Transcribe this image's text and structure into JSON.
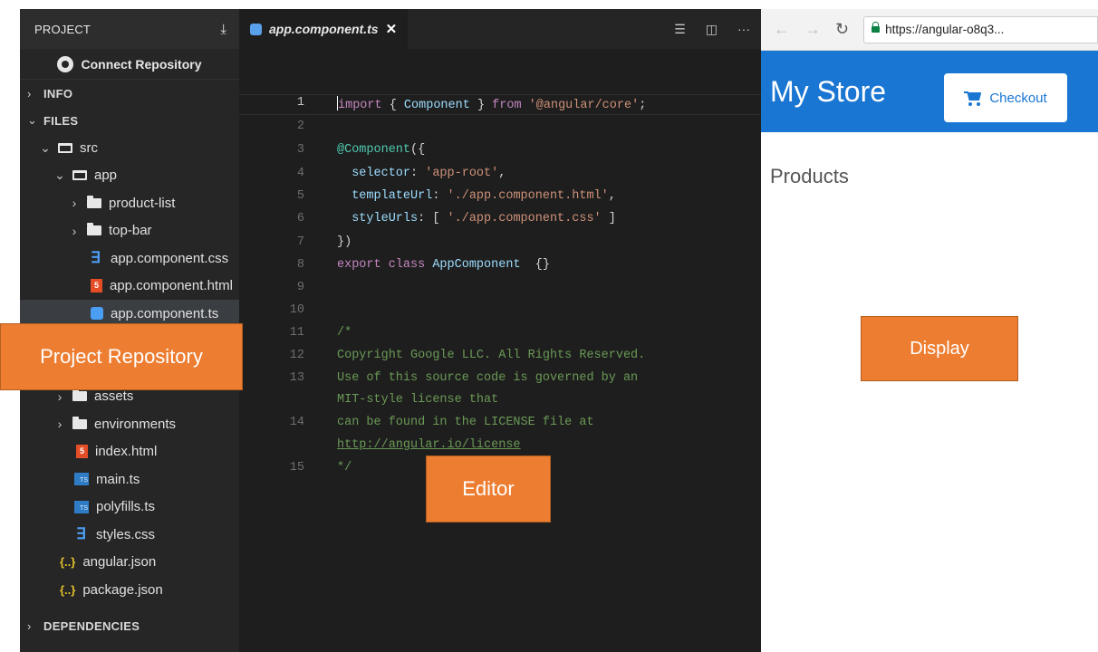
{
  "sidebar": {
    "header_title": "PROJECT",
    "connect_label": "Connect Repository",
    "sections": {
      "info": "INFO",
      "files": "FILES",
      "dependencies": "DEPENDENCIES"
    },
    "tree": [
      {
        "label": "src",
        "icon": "folder-open-icon",
        "expanded": true
      },
      {
        "label": "app",
        "icon": "folder-open-icon",
        "expanded": true
      },
      {
        "label": "product-list",
        "icon": "folder-icon",
        "expanded": false
      },
      {
        "label": "top-bar",
        "icon": "folder-icon",
        "expanded": false
      },
      {
        "label": "app.component.css",
        "icon": "css-file-icon"
      },
      {
        "label": "app.component.html",
        "icon": "html-file-icon"
      },
      {
        "label": "app.component.ts",
        "icon": "angular-file-icon",
        "selected": true
      },
      {
        "label": "assets",
        "icon": "folder-icon",
        "expanded": false
      },
      {
        "label": "environments",
        "icon": "folder-icon",
        "expanded": false
      },
      {
        "label": "index.html",
        "icon": "html-file-icon"
      },
      {
        "label": "main.ts",
        "icon": "ts-file-icon"
      },
      {
        "label": "polyfills.ts",
        "icon": "ts-file-icon"
      },
      {
        "label": "styles.css",
        "icon": "css-file-icon"
      },
      {
        "label": "angular.json",
        "icon": "json-file-icon"
      },
      {
        "label": "package.json",
        "icon": "json-file-icon"
      }
    ]
  },
  "editor": {
    "tab_name": "app.component.ts",
    "line_numbers": [
      "1",
      "2",
      "3",
      "4",
      "5",
      "6",
      "7",
      "8",
      "9",
      "10",
      "11",
      "12",
      "13",
      "14",
      "15"
    ],
    "code": {
      "l1_kw": "import",
      "l1_a": " { ",
      "l1_type": "Component",
      "l1_b": " } ",
      "l1_from": "from",
      "l1_str": " '@angular/core'",
      "l1_end": ";",
      "l3_dec": "@Component",
      "l3_rest": "({",
      "l4_key": "selector",
      "l4_colon": ": ",
      "l4_str": "'app-root'",
      "l4_end": ",",
      "l5_key": "templateUrl",
      "l5_colon": ": ",
      "l5_str": "'./app.component.html'",
      "l5_end": ",",
      "l6_key": "styleUrls",
      "l6_colon": ": [ ",
      "l6_str": "'./app.component.css'",
      "l6_end": " ]",
      "l7": "})",
      "l8_kw1": "export",
      "l8_kw2": " class ",
      "l8_type": "AppComponent",
      "l8_rest": "  {}",
      "l11": "/*",
      "l12": "Copyright Google LLC. All Rights Reserved.",
      "l13a": "Use of this source code is governed by an",
      "l13b": "MIT-style license that",
      "l14a": "can be found in the LICENSE file at",
      "l14b": "http://angular.io/license",
      "l15": "*/"
    }
  },
  "browser": {
    "url": "https://angular-o8q3...",
    "store_title": "My Store",
    "checkout_label": "Checkout",
    "products_heading": "Products"
  },
  "annotations": {
    "project": "Project Repository",
    "editor": "Editor",
    "display": "Display"
  },
  "colors": {
    "sidebar_bg": "#262626",
    "editor_bg": "#1e1e1e",
    "store_bar": "#1976d2",
    "callout": "#ed7d31"
  }
}
